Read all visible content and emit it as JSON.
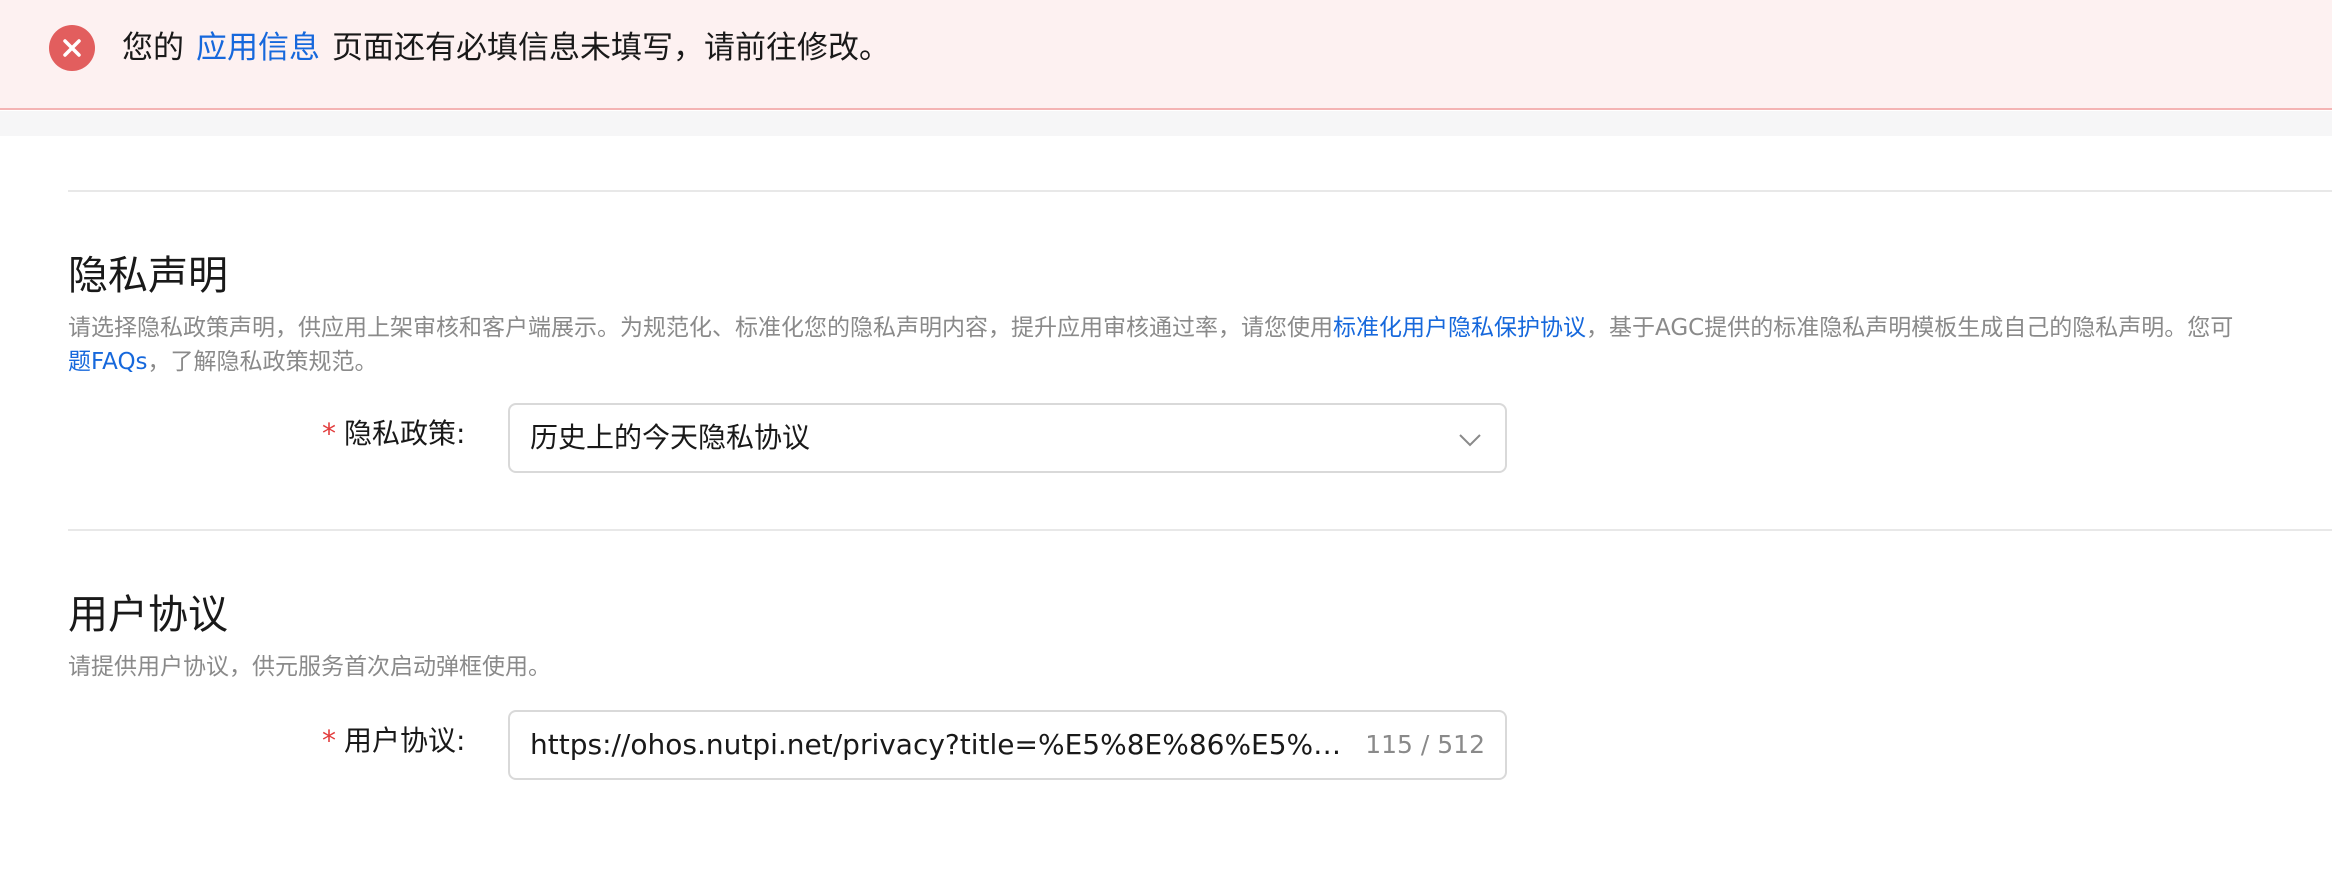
{
  "alert": {
    "icon": "close-circle-icon",
    "text_before": "您的",
    "link": "应用信息",
    "text_after": "页面还有必填信息未填写，请前往修改。",
    "colors": {
      "bg": "#fdf1f1",
      "icon": "#e25e5e",
      "link": "#1668dc"
    }
  },
  "privacy": {
    "title": "隐私声明",
    "desc_line1_before": "请选择隐私政策声明，供应用上架审核和客户端展示。为规范化、标准化您的隐私声明内容，提升应用审核通过率，请您使用",
    "desc_link1": "标准化用户隐私保护协议",
    "desc_line1_after": "，基于AGC提供的标准隐私声明模板生成自己的隐私声明。您可",
    "desc_link2": "题FAQs",
    "desc_line2_after": "，了解隐私政策规范。",
    "field_label": "隐私政策:",
    "field_value": "历史上的今天隐私协议",
    "dropdown_icon": "chevron-down-icon"
  },
  "user_agreement": {
    "title": "用户协议",
    "desc": "请提供用户协议，供元服务首次启动弹框使用。",
    "field_label": "用户协议:",
    "field_value": "https://ohos.nutpi.net/privacy?title=%E5%8E%86%E5%8F…",
    "counter": "115 / 512"
  },
  "required_mark": "*"
}
